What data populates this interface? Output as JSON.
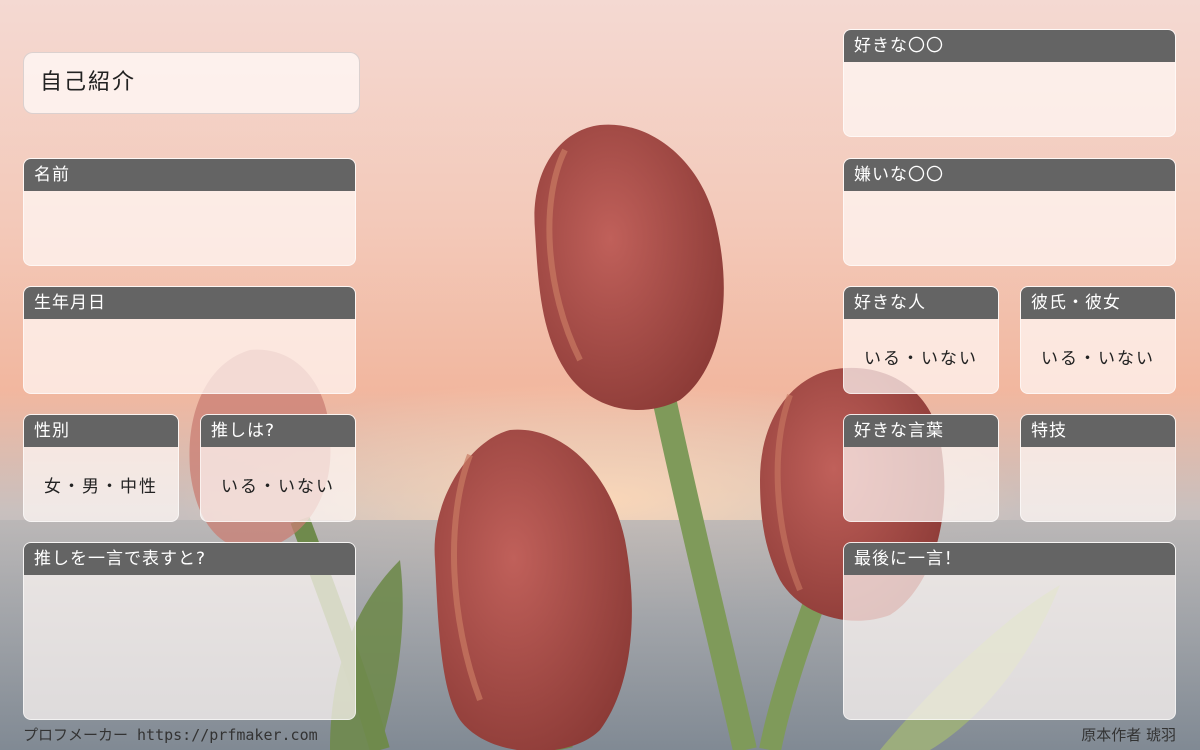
{
  "title": "自己紹介",
  "panels": {
    "name": {
      "label": "名前",
      "value": ""
    },
    "birthday": {
      "label": "生年月日",
      "value": ""
    },
    "gender": {
      "label": "性別",
      "value": "女・男・中性"
    },
    "oshi": {
      "label": "推しは?",
      "value": "いる・いない"
    },
    "oshi_word": {
      "label": "推しを一言で表すと?",
      "value": ""
    },
    "likes": {
      "label": "好きな〇〇",
      "value": ""
    },
    "dislikes": {
      "label": "嫌いな〇〇",
      "value": ""
    },
    "crush": {
      "label": "好きな人",
      "value": "いる・いない"
    },
    "partner": {
      "label": "彼氏・彼女",
      "value": "いる・いない"
    },
    "fav_words": {
      "label": "好きな言葉",
      "value": ""
    },
    "skill": {
      "label": "特技",
      "value": ""
    },
    "last_word": {
      "label": "最後に一言！",
      "value": ""
    }
  },
  "footer": {
    "left": "プロフメーカー https://prfmaker.com",
    "right": "原本作者 琥羽"
  },
  "colors": {
    "header": "#646464",
    "panel_bg": "#fff8f5",
    "tulip": "#a84a45",
    "stem": "#7f9a5a"
  }
}
